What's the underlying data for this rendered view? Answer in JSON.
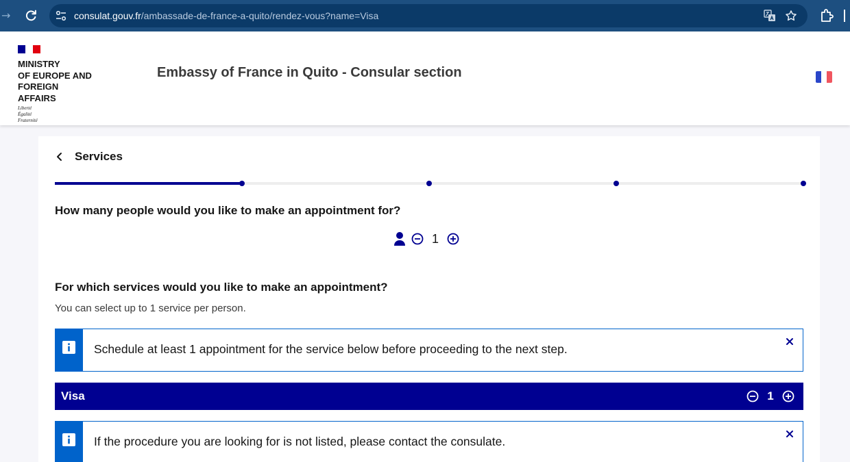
{
  "browser": {
    "url_host": "consulat.gouv.fr",
    "url_path": "/ambassade-de-france-a-quito/rendez-vous?name=Visa",
    "bar_color": "#1d4f80"
  },
  "header": {
    "ministry_lines": [
      "MINISTRY",
      "OF EUROPE AND FOREIGN",
      "AFFAIRS"
    ],
    "motto_lines": [
      "Liberté",
      "Égalité",
      "Fraternité"
    ],
    "site_title": "Embassy of France in Quito - Consular section",
    "language_flag": "fr-flag-icon"
  },
  "main": {
    "back_label": "Services",
    "stepper": {
      "current_step": 1,
      "total_steps": 4,
      "progress": 0.25
    },
    "people_question": "How many people would you like to make an appointment for?",
    "people_count": "1",
    "services_question": "For which services would you like to make an appointment?",
    "services_hint": "You can select up to 1 service per person.",
    "alerts": [
      {
        "text": "Schedule at least 1 appointment for the service below before proceeding to the next step."
      },
      {
        "text": "If the procedure you are looking for is not listed, please contact the consulate."
      }
    ],
    "service": {
      "name": "Visa",
      "count": "1"
    }
  },
  "colors": {
    "primary": "#000091",
    "info": "#0063cb",
    "flag_blue": "#000091",
    "flag_white": "#ffffff",
    "flag_red": "#e1000f"
  }
}
